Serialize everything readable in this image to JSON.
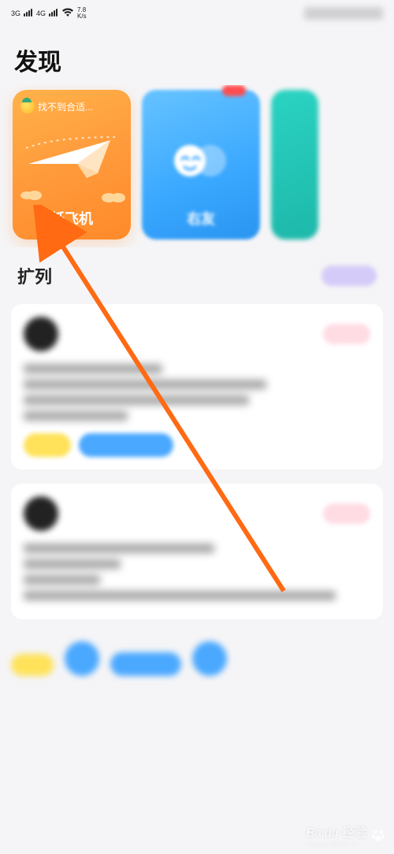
{
  "status": {
    "net1": "3G",
    "net2": "4G",
    "speed_top": "7.8",
    "speed_bottom": "K/s"
  },
  "page_title": "发现",
  "cards": {
    "orange": {
      "tagline": "找不到合适...",
      "label": "纸飞机"
    },
    "blue": {
      "label": "右友"
    },
    "teal": {
      "label": ""
    }
  },
  "section": {
    "title": "扩列"
  },
  "watermark": {
    "brand": "Baidu",
    "suffix": "经验",
    "sub": "jingyan.baidu.cn"
  },
  "colors": {
    "accent_orange": "#ff8a2a",
    "accent_blue": "#3aa8ff",
    "accent_teal": "#1db8aa",
    "arrow": "#ff6a13"
  }
}
